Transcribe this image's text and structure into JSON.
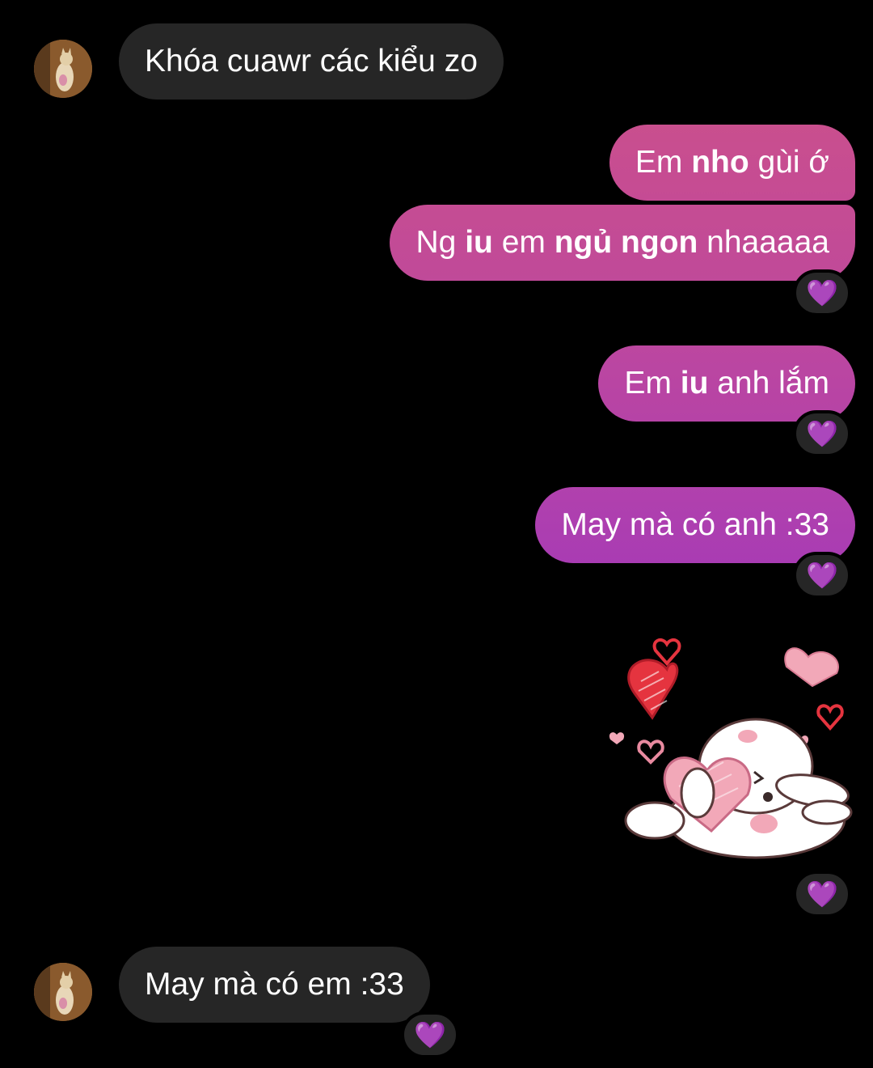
{
  "conversation": {
    "messages": [
      {
        "sender": "other",
        "text": "Khóa cuawr các kiểu zo"
      },
      {
        "sender": "me",
        "parts": [
          {
            "t": "Em ",
            "b": false
          },
          {
            "t": "nho",
            "b": true
          },
          {
            "t": " gùi ớ",
            "b": false
          }
        ]
      },
      {
        "sender": "me",
        "parts": [
          {
            "t": "Ng ",
            "b": false
          },
          {
            "t": "iu",
            "b": true
          },
          {
            "t": " em ",
            "b": false
          },
          {
            "t": "ngủ ngon",
            "b": true
          },
          {
            "t": " nhaaaaa",
            "b": false
          }
        ],
        "reaction": "💜"
      },
      {
        "sender": "me",
        "parts": [
          {
            "t": "Em ",
            "b": false
          },
          {
            "t": "iu",
            "b": true
          },
          {
            "t": " anh lắm",
            "b": false
          }
        ],
        "reaction": "💜"
      },
      {
        "sender": "me",
        "text": "May mà có anh :33",
        "reaction": "💜"
      },
      {
        "sender": "me",
        "sticker": "bunny-hugging-heart-sticker",
        "reaction": "💜"
      },
      {
        "sender": "other",
        "text": "May mà có em :33",
        "reaction": "💜"
      }
    ]
  },
  "colors": {
    "background": "#000000",
    "incoming_bubble": "#262626",
    "outgoing_gradient_top": "#c94f8e",
    "outgoing_gradient_bottom": "#a93cb3",
    "reaction_heart": "#9b3cf0"
  }
}
